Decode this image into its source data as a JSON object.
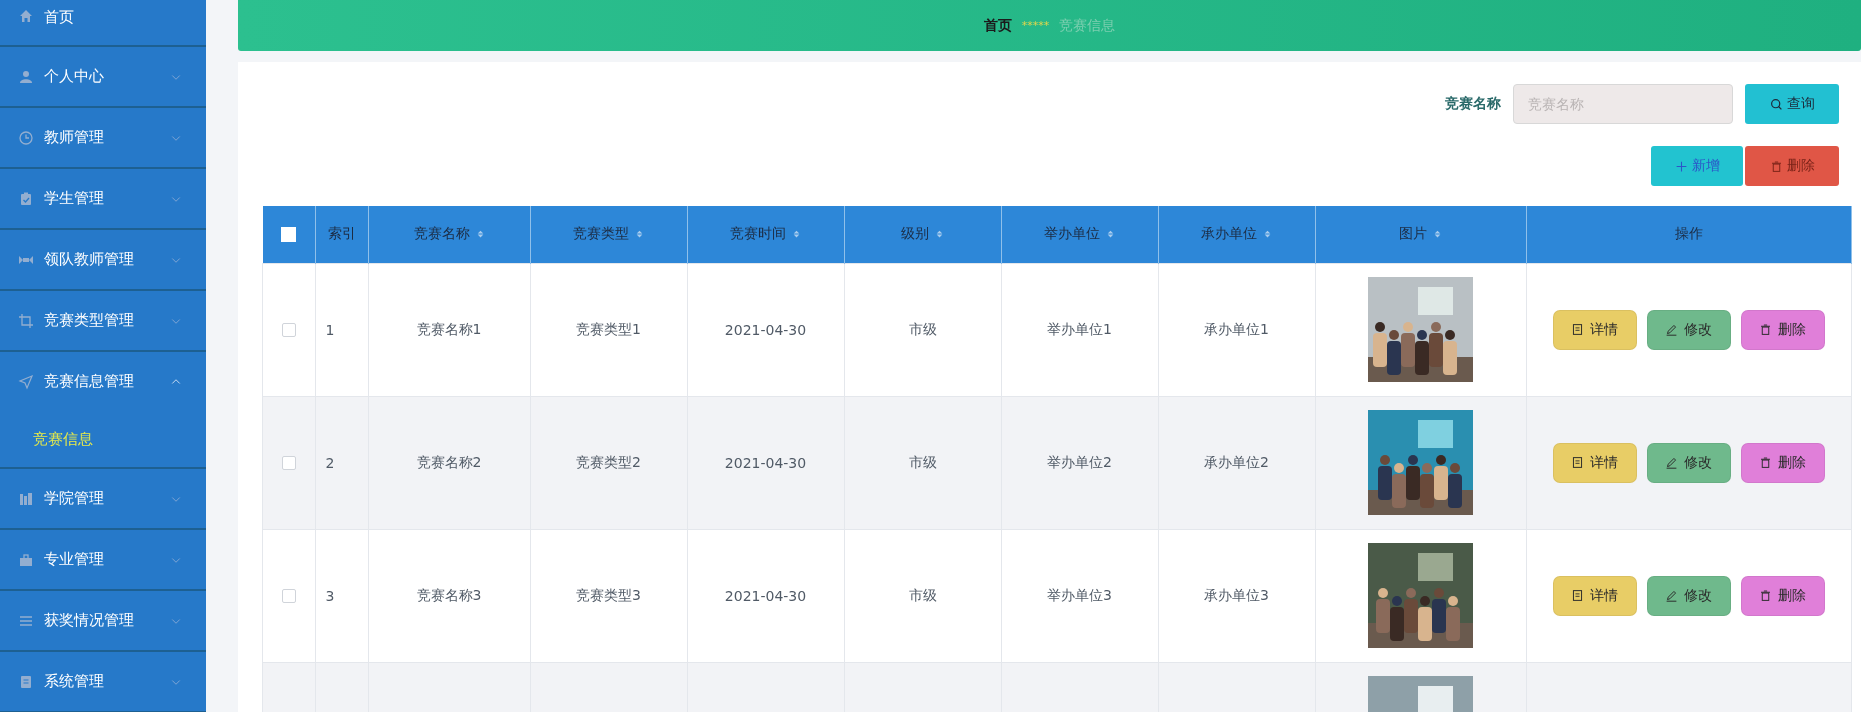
{
  "sidebar": {
    "items": [
      {
        "label": "首页",
        "kind": "link"
      },
      {
        "label": "个人中心",
        "kind": "submenu",
        "expanded": false
      },
      {
        "label": "教师管理",
        "kind": "submenu",
        "expanded": false
      },
      {
        "label": "学生管理",
        "kind": "submenu",
        "expanded": false
      },
      {
        "label": "领队教师管理",
        "kind": "submenu",
        "expanded": false
      },
      {
        "label": "竞赛类型管理",
        "kind": "submenu",
        "expanded": false
      },
      {
        "label": "竞赛信息管理",
        "kind": "submenu",
        "expanded": true,
        "children": [
          {
            "label": "竞赛信息",
            "selected": true
          }
        ]
      },
      {
        "label": "学院管理",
        "kind": "submenu",
        "expanded": false
      },
      {
        "label": "专业管理",
        "kind": "submenu",
        "expanded": false
      },
      {
        "label": "获奖情况管理",
        "kind": "submenu",
        "expanded": false
      },
      {
        "label": "系统管理",
        "kind": "submenu",
        "expanded": false
      }
    ]
  },
  "breadcrumb": {
    "items": [
      "首页",
      "竞赛信息"
    ],
    "separator": "*****"
  },
  "search": {
    "label": "竞赛名称",
    "placeholder": "竞赛名称",
    "button": "查询"
  },
  "actions": [
    {
      "label": "新增",
      "kind": "add"
    },
    {
      "label": "删除",
      "kind": "delete"
    }
  ],
  "table": {
    "columns": [
      {
        "label": "索引",
        "sortable": false
      },
      {
        "label": "竞赛名称",
        "sortable": true
      },
      {
        "label": "竞赛类型",
        "sortable": true
      },
      {
        "label": "竞赛时间",
        "sortable": true
      },
      {
        "label": "级别",
        "sortable": true
      },
      {
        "label": "举办单位",
        "sortable": true
      },
      {
        "label": "承办单位",
        "sortable": true
      },
      {
        "label": "图片",
        "sortable": true
      },
      {
        "label": "操作",
        "sortable": false
      }
    ],
    "header_checkbox": {
      "checked": false
    },
    "rows": [
      {
        "checked": false,
        "index": "1",
        "name": "竞赛名称1",
        "type": "竞赛类型1",
        "time": "2021-04-30",
        "level": "市级",
        "host": "举办单位1",
        "organizer": "承办单位1",
        "image": {
          "kind": "picture"
        },
        "buttons": [
          "详情",
          "修改",
          "删除"
        ]
      },
      {
        "checked": false,
        "index": "2",
        "name": "竞赛名称2",
        "type": "竞赛类型2",
        "time": "2021-04-30",
        "level": "市级",
        "host": "举办单位2",
        "organizer": "承办单位2",
        "image": {
          "kind": "picture"
        },
        "buttons": [
          "详情",
          "修改",
          "删除"
        ]
      },
      {
        "checked": false,
        "index": "3",
        "name": "竞赛名称3",
        "type": "竞赛类型3",
        "time": "2021-04-30",
        "level": "市级",
        "host": "举办单位3",
        "organizer": "承办单位3",
        "image": {
          "kind": "picture"
        },
        "buttons": [
          "详情",
          "修改",
          "删除"
        ]
      },
      {
        "image": {
          "kind": "picture"
        }
      }
    ]
  }
}
